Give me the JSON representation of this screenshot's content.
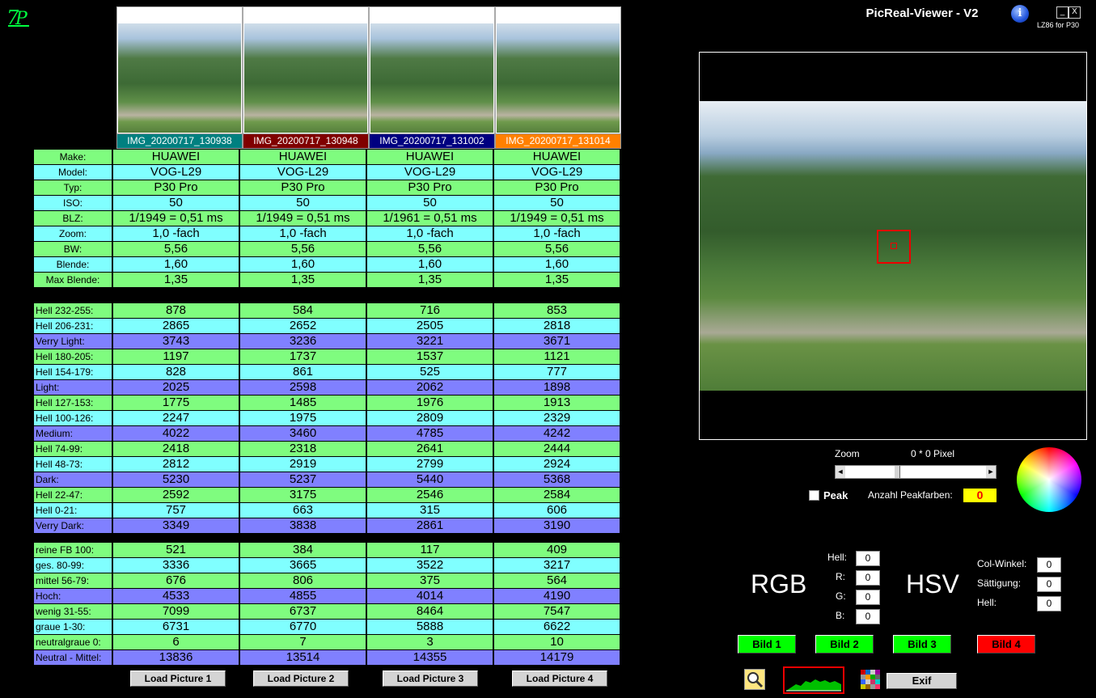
{
  "app": {
    "title": "PicReal-Viewer - V2",
    "subtitle": "LZ86 for P30",
    "min_label": "_",
    "close_label": "X",
    "info_label": "i",
    "logo": "7P"
  },
  "pictures": [
    {
      "filename": "IMG_20200717_130938",
      "color": "#008080",
      "load_label": "Load Picture 1"
    },
    {
      "filename": "IMG_20200717_130948",
      "color": "#800000",
      "load_label": "Load Picture 2"
    },
    {
      "filename": "IMG_20200717_131002",
      "color": "#000080",
      "load_label": "Load Picture 3"
    },
    {
      "filename": "IMG_20200717_131014",
      "color": "#ff8000",
      "load_label": "Load Picture 4"
    }
  ],
  "exif_rows": [
    {
      "label": "Make:",
      "values": [
        "HUAWEI",
        "HUAWEI",
        "HUAWEI",
        "HUAWEI"
      ]
    },
    {
      "label": "Model:",
      "values": [
        "VOG-L29",
        "VOG-L29",
        "VOG-L29",
        "VOG-L29"
      ]
    },
    {
      "label": "Typ:",
      "values": [
        "P30 Pro",
        "P30 Pro",
        "P30 Pro",
        "P30 Pro"
      ]
    },
    {
      "label": "ISO:",
      "values": [
        "50",
        "50",
        "50",
        "50"
      ]
    },
    {
      "label": "BLZ:",
      "values": [
        "1/1949 = 0,51 ms",
        "1/1949 = 0,51 ms",
        "1/1961 = 0,51 ms",
        "1/1949 = 0,51 ms"
      ]
    },
    {
      "label": "Zoom:",
      "values": [
        "1,0 -fach",
        "1,0 -fach",
        "1,0 -fach",
        "1,0 -fach"
      ]
    },
    {
      "label": "BW:",
      "values": [
        "5,56",
        "5,56",
        "5,56",
        "5,56"
      ]
    },
    {
      "label": "Blende:",
      "values": [
        "1,60",
        "1,60",
        "1,60",
        "1,60"
      ]
    },
    {
      "label": "Max Blende:",
      "values": [
        "1,35",
        "1,35",
        "1,35",
        "1,35"
      ]
    }
  ],
  "light_rows": [
    {
      "label": "Hell 232-255:",
      "values": [
        "878",
        "584",
        "716",
        "853"
      ]
    },
    {
      "label": "Hell 206-231:",
      "values": [
        "2865",
        "2652",
        "2505",
        "2818"
      ]
    },
    {
      "label": "Verry Light:",
      "values": [
        "3743",
        "3236",
        "3221",
        "3671"
      ]
    },
    {
      "label": "Hell 180-205:",
      "values": [
        "1197",
        "1737",
        "1537",
        "1121"
      ]
    },
    {
      "label": "Hell 154-179:",
      "values": [
        "828",
        "861",
        "525",
        "777"
      ]
    },
    {
      "label": "Light:",
      "values": [
        "2025",
        "2598",
        "2062",
        "1898"
      ]
    },
    {
      "label": "Hell 127-153:",
      "values": [
        "1775",
        "1485",
        "1976",
        "1913"
      ]
    },
    {
      "label": "Hell 100-126:",
      "values": [
        "2247",
        "1975",
        "2809",
        "2329"
      ]
    },
    {
      "label": "Medium:",
      "values": [
        "4022",
        "3460",
        "4785",
        "4242"
      ]
    },
    {
      "label": "Hell 74-99:",
      "values": [
        "2418",
        "2318",
        "2641",
        "2444"
      ]
    },
    {
      "label": "Hell 48-73:",
      "values": [
        "2812",
        "2919",
        "2799",
        "2924"
      ]
    },
    {
      "label": "Dark:",
      "values": [
        "5230",
        "5237",
        "5440",
        "5368"
      ]
    },
    {
      "label": "Hell 22-47:",
      "values": [
        "2592",
        "3175",
        "2546",
        "2584"
      ]
    },
    {
      "label": "Hell 0-21:",
      "values": [
        "757",
        "663",
        "315",
        "606"
      ]
    },
    {
      "label": "Verry Dark:",
      "values": [
        "3349",
        "3838",
        "2861",
        "3190"
      ]
    }
  ],
  "color_rows": [
    {
      "label": "reine FB 100:",
      "values": [
        "521",
        "384",
        "117",
        "409"
      ]
    },
    {
      "label": "ges. 80-99:",
      "values": [
        "3336",
        "3665",
        "3522",
        "3217"
      ]
    },
    {
      "label": "mittel 56-79:",
      "values": [
        "676",
        "806",
        "375",
        "564"
      ]
    },
    {
      "label": "Hoch:",
      "values": [
        "4533",
        "4855",
        "4014",
        "4190"
      ]
    },
    {
      "label": "wenig 31-55:",
      "values": [
        "7099",
        "6737",
        "8464",
        "7547"
      ]
    },
    {
      "label": "graue  1-30:",
      "values": [
        "6731",
        "6770",
        "5888",
        "6622"
      ]
    },
    {
      "label": "neutralgraue 0:",
      "values": [
        "6",
        "7",
        "3",
        "10"
      ]
    },
    {
      "label": "Neutral - Mittel:",
      "values": [
        "13836",
        "13514",
        "14355",
        "14179"
      ]
    }
  ],
  "zoom": {
    "label": "Zoom",
    "pixel_label": "0 * 0 Pixel",
    "slider_position": 0.36
  },
  "peak": {
    "label": "Peak",
    "count_label": "Anzahl Peakfarben:",
    "count_value": "0",
    "checked": false
  },
  "rgb": {
    "title": "RGB",
    "hell_label": "Hell:",
    "hell": "0",
    "r_label": "R:",
    "r": "0",
    "g_label": "G:",
    "g": "0",
    "b_label": "B:",
    "b": "0"
  },
  "hsv": {
    "title": "HSV",
    "winkel_label": "Col-Winkel:",
    "winkel": "0",
    "saett_label": "Sättigung:",
    "saett": "0",
    "hell_label": "Hell:",
    "hell": "0"
  },
  "bild_buttons": [
    {
      "label": "Bild 1",
      "color": "#00ff00"
    },
    {
      "label": "Bild 2",
      "color": "#00ff00"
    },
    {
      "label": "Bild 3",
      "color": "#00ff00"
    },
    {
      "label": "Bild 4",
      "color": "#ff0000"
    }
  ],
  "tools": {
    "exif_label": "Exif",
    "icons": [
      "search-icon",
      "histogram-icon",
      "palette-icon"
    ]
  }
}
